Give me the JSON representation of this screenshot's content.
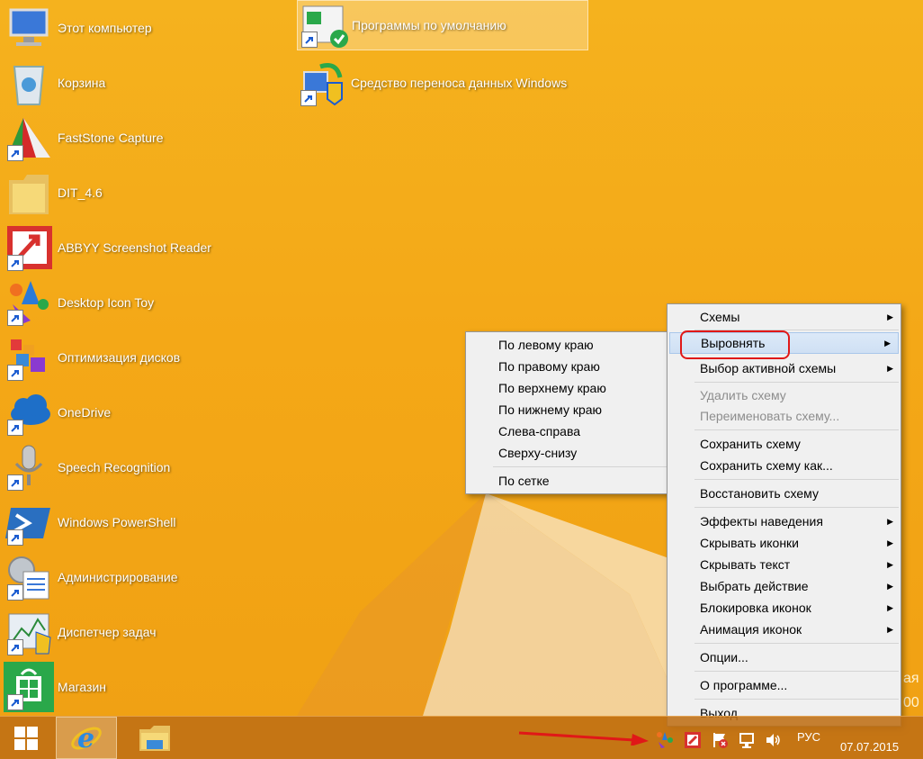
{
  "desktop": {
    "icons": [
      {
        "label": "Этот компьютер",
        "icon": "computer-icon"
      },
      {
        "label": "Корзина",
        "icon": "recycle-bin-icon"
      },
      {
        "label": "FastStone Capture",
        "icon": "faststone-icon"
      },
      {
        "label": "DIT_4.6",
        "icon": "folder-icon"
      },
      {
        "label": "ABBYY Screenshot Reader",
        "icon": "abbyy-icon"
      },
      {
        "label": "Desktop Icon Toy",
        "icon": "desktop-icon-toy-icon"
      },
      {
        "label": "Оптимизация дисков",
        "icon": "defrag-icon"
      },
      {
        "label": "OneDrive",
        "icon": "onedrive-icon"
      },
      {
        "label": "Speech Recognition",
        "icon": "microphone-icon"
      },
      {
        "label": "Windows PowerShell",
        "icon": "powershell-icon"
      },
      {
        "label": "Администрирование",
        "icon": "admin-tools-icon"
      },
      {
        "label": "Диспетчер задач",
        "icon": "task-manager-icon"
      },
      {
        "label": "Магазин",
        "icon": "store-icon"
      }
    ],
    "icons_col2": [
      {
        "label": "Программы по умолчанию",
        "icon": "default-programs-icon"
      },
      {
        "label": "Средство переноса данных Windows",
        "icon": "easy-transfer-icon"
      }
    ]
  },
  "context_menu": {
    "items": [
      {
        "label": "Схемы",
        "submenu": true
      },
      {
        "label": "Выровнять",
        "submenu": true,
        "highlighted": true
      },
      {
        "label": "Выбор активной схемы",
        "submenu": true
      },
      {
        "label": "Удалить схему",
        "disabled": true
      },
      {
        "label": "Переименовать схему...",
        "disabled": true
      },
      {
        "label": "Сохранить схему"
      },
      {
        "label": "Сохранить схему как..."
      },
      {
        "label": "Восстановить схему"
      },
      {
        "label": "Эффекты наведения",
        "submenu": true
      },
      {
        "label": "Скрывать иконки",
        "submenu": true
      },
      {
        "label": "Скрывать текст",
        "submenu": true
      },
      {
        "label": "Выбрать действие",
        "submenu": true
      },
      {
        "label": "Блокировка иконок",
        "submenu": true
      },
      {
        "label": "Анимация иконок",
        "submenu": true
      },
      {
        "label": "Опции..."
      },
      {
        "label": "О программе..."
      },
      {
        "label": "Выход"
      }
    ]
  },
  "submenu": {
    "items": [
      {
        "label": "По левому краю"
      },
      {
        "label": "По правому краю"
      },
      {
        "label": "По верхнему краю"
      },
      {
        "label": "По нижнему краю"
      },
      {
        "label": "Слева-справа"
      },
      {
        "label": "Сверху-снизу"
      },
      {
        "label": "По сетке"
      }
    ]
  },
  "taskbar": {
    "language": "РУС",
    "date": "07.07.2015",
    "partial_text_a": "ая",
    "partial_text_b": "00"
  },
  "colors": {
    "wallpaper": "#f4a817",
    "taskbar": "#be6e14",
    "highlight_ring": "#e01818",
    "arrow": "#e01818"
  }
}
